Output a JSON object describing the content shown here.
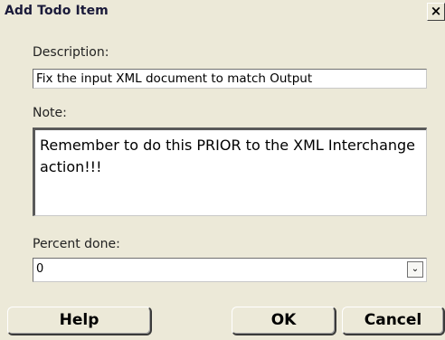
{
  "window": {
    "title": "Add Todo Item",
    "close_glyph": "×"
  },
  "form": {
    "description_label": "Description:",
    "description_value": "Fix the input XML document to match Output",
    "note_label": "Note:",
    "note_value": "Remember to do this PRIOR to the XML Interchange action!!!",
    "percent_label": "Percent done:",
    "percent_value": "0",
    "dropdown_glyph": "⌄"
  },
  "buttons": {
    "help": "Help",
    "ok": "OK",
    "cancel": "Cancel"
  }
}
